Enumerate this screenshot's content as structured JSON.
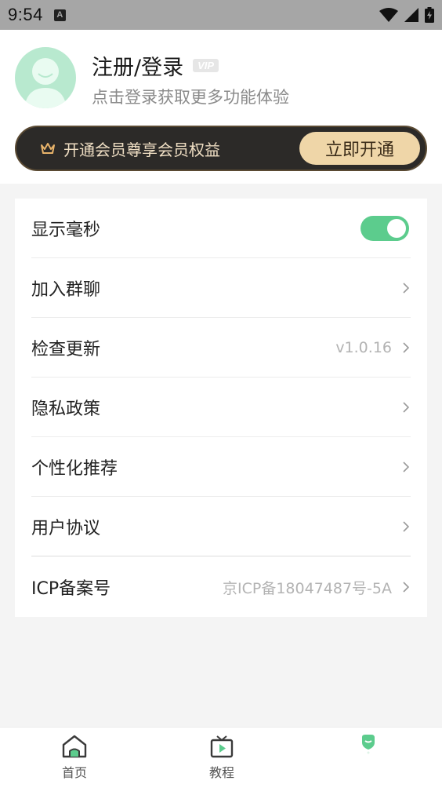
{
  "status_bar": {
    "time": "9:54",
    "notification_icon": "A"
  },
  "profile": {
    "title": "注册/登录",
    "vip_badge": "VIP",
    "subtitle": "点击登录获取更多功能体验"
  },
  "vip_banner": {
    "text": "开通会员尊享会员权益",
    "button_label": "立即开通"
  },
  "settings": {
    "show_ms_label": "显示毫秒",
    "show_ms_enabled": true,
    "join_group_label": "加入群聊",
    "check_update_label": "检查更新",
    "check_update_value": "v1.0.16",
    "privacy_label": "隐私政策",
    "personalize_label": "个性化推荐",
    "user_agreement_label": "用户协议",
    "icp_label": "ICP备案号",
    "icp_value": "京ICP备18047487号-5A"
  },
  "bottom_nav": {
    "home_label": "首页",
    "tutorial_label": "教程"
  },
  "colors": {
    "accent_green": "#5ccc8d",
    "vip_gold": "#efd6a8",
    "banner_dark": "#2c2a28"
  }
}
